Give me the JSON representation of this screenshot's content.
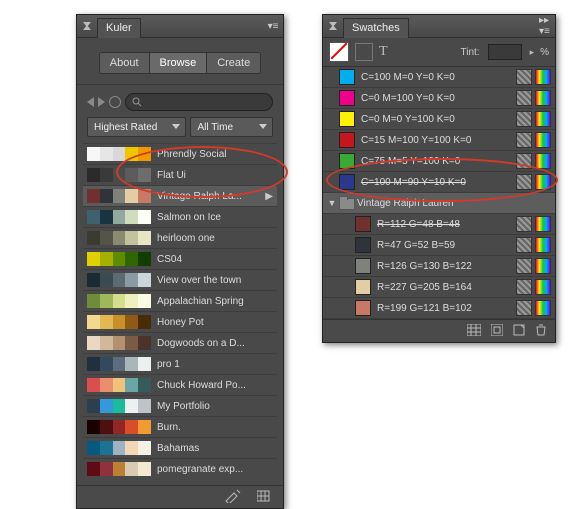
{
  "kuler": {
    "title": "Kuler",
    "tabs": {
      "about": "About",
      "browse": "Browse",
      "create": "Create"
    },
    "sort_label": "Highest Rated",
    "time_label": "All Time",
    "items": [
      {
        "name": "Phrendly Social",
        "colors": [
          "#f7f7f7",
          "#e6e6e6",
          "#d8d8d8",
          "#f0c600",
          "#f19a00"
        ]
      },
      {
        "name": "Flat Ui",
        "colors": [
          "#2b2b2b",
          "#3a3a3a",
          "#4b4b4b",
          "#5c5c5c",
          "#6d6d6d"
        ]
      },
      {
        "name": "Vintage Ralph La...",
        "colors": [
          "#703030",
          "#2f343b",
          "#7e827a",
          "#e3cda4",
          "#c77966"
        ],
        "selected": true,
        "arrow": true
      },
      {
        "name": "Salmon on Ice",
        "colors": [
          "#3e606f",
          "#193441",
          "#91aa9d",
          "#d1dbbd",
          "#fcfff5"
        ]
      },
      {
        "name": "heirloom one",
        "colors": [
          "#3b3b30",
          "#555547",
          "#8a8a73",
          "#c2c29f",
          "#e6e6c7"
        ]
      },
      {
        "name": "CS04",
        "colors": [
          "#e2cf00",
          "#a6b000",
          "#5c8c00",
          "#2f6600",
          "#123d00"
        ]
      },
      {
        "name": "View over the town",
        "colors": [
          "#1b2b34",
          "#3b4b54",
          "#5b6b74",
          "#8b9ba4",
          "#cbd5dc"
        ]
      },
      {
        "name": "Appalachian Spring",
        "colors": [
          "#6f8c3a",
          "#9fb85a",
          "#d3df8e",
          "#f0efc0",
          "#fbfbe3"
        ]
      },
      {
        "name": "Honey Pot",
        "colors": [
          "#f2d98d",
          "#e2b853",
          "#c98f2b",
          "#8f5a13",
          "#4a2b08"
        ]
      },
      {
        "name": "Dogwoods on a D...",
        "colors": [
          "#e9d8c4",
          "#d1b89a",
          "#b29070",
          "#7b5a46",
          "#4a3328"
        ]
      },
      {
        "name": "pro 1",
        "colors": [
          "#222f3e",
          "#34495e",
          "#5d6d7e",
          "#aab7b8",
          "#ecf0f1"
        ]
      },
      {
        "name": "Chuck Howard Po...",
        "colors": [
          "#d94f4f",
          "#ea8f6e",
          "#f0c27b",
          "#6aa6a6",
          "#355c5c"
        ]
      },
      {
        "name": "My Portfolio",
        "colors": [
          "#2c3e50",
          "#3498db",
          "#1abc9c",
          "#ecf0f1",
          "#bdc3c7"
        ]
      },
      {
        "name": "Burn.",
        "colors": [
          "#1a0000",
          "#4d0f0f",
          "#912626",
          "#d84e2a",
          "#f29b30"
        ]
      },
      {
        "name": "Bahamas",
        "colors": [
          "#065a82",
          "#1c7293",
          "#9eb3c2",
          "#f1d6b8",
          "#f7f1e5"
        ]
      },
      {
        "name": "pomegranate exp...",
        "colors": [
          "#5e0b15",
          "#90323d",
          "#bc8034",
          "#d9cab3",
          "#f3e9d2"
        ]
      }
    ]
  },
  "swatches": {
    "title": "Swatches",
    "tint_label": "Tint:",
    "tint_value": "",
    "tint_pct": "%",
    "rows": [
      {
        "type": "swatch",
        "name": "C=100 M=0 Y=0 K=0",
        "color": "#00aeef"
      },
      {
        "type": "swatch",
        "name": "C=0 M=100 Y=0 K=0",
        "color": "#ec008c"
      },
      {
        "type": "swatch",
        "name": "C=0 M=0 Y=100 K=0",
        "color": "#fff200"
      },
      {
        "type": "swatch",
        "name": "C=15 M=100 Y=100 K=0",
        "color": "#c4161c"
      },
      {
        "type": "swatch",
        "name": "C=75 M=5 Y=100 K=0",
        "color": "#3aa935"
      },
      {
        "type": "swatch",
        "name": "C=100 M=90 Y=10 K=0",
        "color": "#2a3890",
        "strike": true
      },
      {
        "type": "folder",
        "name": "Vintage Ralph Lauren",
        "selected": true,
        "open": true
      },
      {
        "type": "swatch",
        "name": "R=112 G=48 B=48",
        "color": "#703030",
        "indent": true,
        "strike": true
      },
      {
        "type": "swatch",
        "name": "R=47 G=52 B=59",
        "color": "#2f343b",
        "indent": true
      },
      {
        "type": "swatch",
        "name": "R=126 G=130 B=122",
        "color": "#7e827a",
        "indent": true
      },
      {
        "type": "swatch",
        "name": "R=227 G=205 B=164",
        "color": "#e3cda4",
        "indent": true
      },
      {
        "type": "swatch",
        "name": "R=199 G=121 B=102",
        "color": "#c77966",
        "indent": true
      }
    ]
  }
}
